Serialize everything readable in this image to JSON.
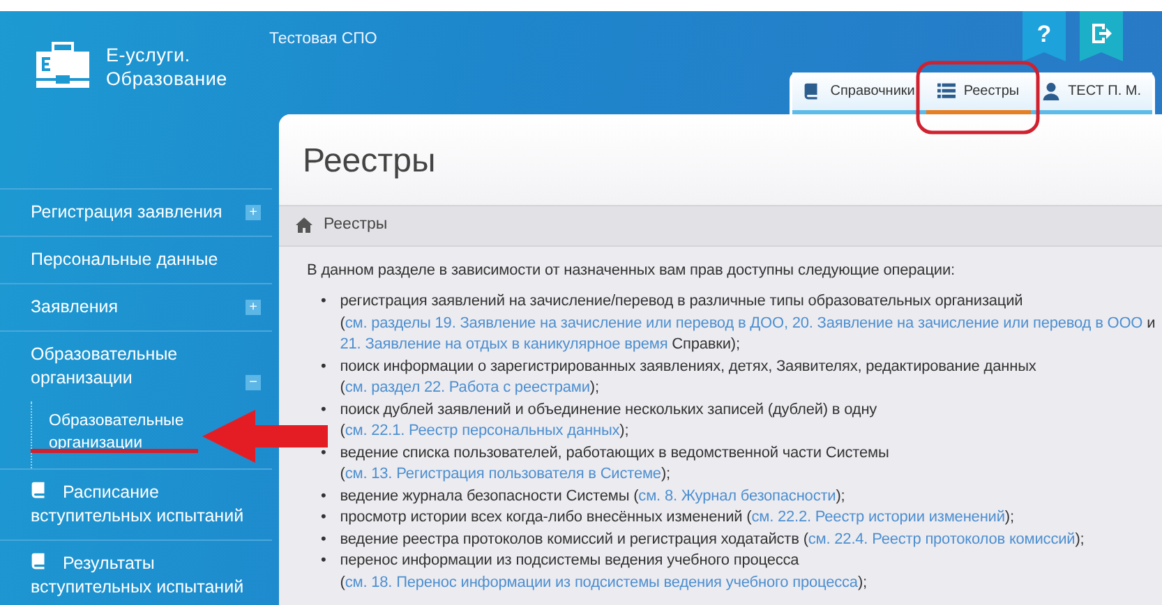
{
  "header": {
    "logo_line1": "Е-услуги.",
    "logo_line2": "Образование",
    "organization": "Тестовая СПО",
    "help_label": "?"
  },
  "tabs": [
    {
      "label": "Справочники",
      "selected": false
    },
    {
      "label": "Реестры",
      "selected": true
    },
    {
      "label": "ТЕСТ П. М.",
      "selected": false
    }
  ],
  "sidebar": {
    "items": [
      {
        "kind": "menu",
        "label": "Регистрация заявления",
        "toggle": "+"
      },
      {
        "kind": "menu",
        "label": "Персональные данные"
      },
      {
        "kind": "menu",
        "label": "Заявления",
        "toggle": "+"
      },
      {
        "kind": "menu",
        "label": "Образовательные организации",
        "toggle": "−",
        "children": [
          {
            "label": "Образовательные организации"
          }
        ]
      },
      {
        "kind": "page",
        "label": "Расписание вступительных испытаний"
      },
      {
        "kind": "page",
        "label": "Результаты вступительных испытаний"
      }
    ]
  },
  "page": {
    "title": "Реестры",
    "breadcrumb": "Реестры",
    "intro": "В данном разделе в зависимости от назначенных вам прав доступны следующие операции:",
    "operations": [
      {
        "marker": "•",
        "segments": [
          {
            "kind": "text",
            "text": "регистрация заявлений на зачисление/перевод в различные типы образовательных организаций ("
          },
          {
            "kind": "link",
            "text": "см. разделы 19. Заявление на зачисление или перевод в ДОО, 20. Заявление на зачисление или перевод в ООО"
          },
          {
            "kind": "text",
            "text": " и "
          },
          {
            "kind": "link",
            "text": "21. Заявление на отдых в каникулярное время"
          },
          {
            "kind": "text",
            "text": " Справки);"
          }
        ]
      },
      {
        "marker": "•",
        "segments": [
          {
            "kind": "text",
            "text": "поиск информации о зарегистрированных заявлениях, детях, Заявителях, редактирование данных ("
          },
          {
            "kind": "link",
            "text": "см. раздел 22. Работа с реестрами"
          },
          {
            "kind": "text",
            "text": ");"
          }
        ]
      },
      {
        "marker": "•",
        "segments": [
          {
            "kind": "text",
            "text": "поиск дублей заявлений и объединение нескольких записей (дублей) в одну ("
          },
          {
            "kind": "link",
            "text": "см. 22.1. Реестр персональных данных"
          },
          {
            "kind": "text",
            "text": ");"
          }
        ]
      },
      {
        "marker": "•",
        "segments": [
          {
            "kind": "text",
            "text": "ведение списка пользователей, работающих в ведомственной части Системы ("
          },
          {
            "kind": "link",
            "text": "см. 13. Регистрация пользователя в Системе"
          },
          {
            "kind": "text",
            "text": ");"
          }
        ]
      },
      {
        "marker": "•",
        "segments": [
          {
            "kind": "text",
            "text": "ведение журнала безопасности Системы ("
          },
          {
            "kind": "link",
            "text": "см. 8. Журнал безопасности"
          },
          {
            "kind": "text",
            "text": ");"
          }
        ]
      },
      {
        "marker": "•",
        "segments": [
          {
            "kind": "text",
            "text": "просмотр истории всех когда-либо внесённых изменений ("
          },
          {
            "kind": "link",
            "text": "см. 22.2. Реестр истории изменений"
          },
          {
            "kind": "text",
            "text": ");"
          }
        ]
      },
      {
        "marker": "•",
        "segments": [
          {
            "kind": "text",
            "text": "ведение реестра протоколов комиссий и регистрация ходатайств ("
          },
          {
            "kind": "link",
            "text": "см. 22.4. Реестр протоколов комиссий"
          },
          {
            "kind": "text",
            "text": ");"
          }
        ]
      },
      {
        "marker": "•",
        "segments": [
          {
            "kind": "text",
            "text": "перенос информации из подсистемы ведения учебного процесса ("
          },
          {
            "kind": "link",
            "text": "см. 18. Перенос информации из подсистемы ведения учебного процесса"
          },
          {
            "kind": "text",
            "text": ");"
          }
        ]
      }
    ]
  }
}
